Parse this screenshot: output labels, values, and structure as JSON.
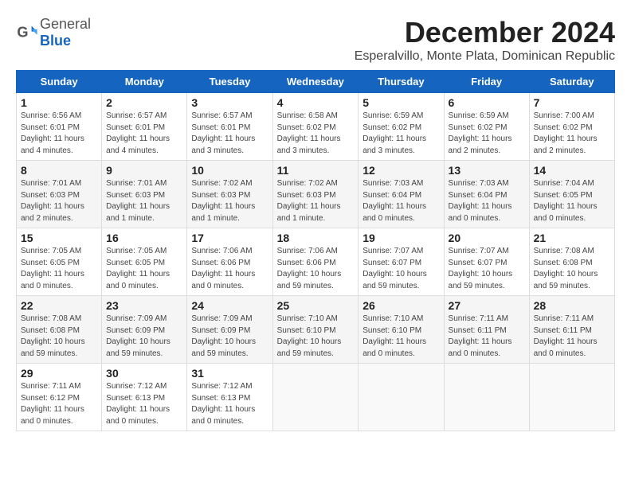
{
  "header": {
    "logo_general": "General",
    "logo_blue": "Blue",
    "month_title": "December 2024",
    "location": "Esperalvillo, Monte Plata, Dominican Republic"
  },
  "weekdays": [
    "Sunday",
    "Monday",
    "Tuesday",
    "Wednesday",
    "Thursday",
    "Friday",
    "Saturday"
  ],
  "weeks": [
    [
      {
        "day": "1",
        "info": "Sunrise: 6:56 AM\nSunset: 6:01 PM\nDaylight: 11 hours and 4 minutes."
      },
      {
        "day": "2",
        "info": "Sunrise: 6:57 AM\nSunset: 6:01 PM\nDaylight: 11 hours and 4 minutes."
      },
      {
        "day": "3",
        "info": "Sunrise: 6:57 AM\nSunset: 6:01 PM\nDaylight: 11 hours and 3 minutes."
      },
      {
        "day": "4",
        "info": "Sunrise: 6:58 AM\nSunset: 6:02 PM\nDaylight: 11 hours and 3 minutes."
      },
      {
        "day": "5",
        "info": "Sunrise: 6:59 AM\nSunset: 6:02 PM\nDaylight: 11 hours and 3 minutes."
      },
      {
        "day": "6",
        "info": "Sunrise: 6:59 AM\nSunset: 6:02 PM\nDaylight: 11 hours and 2 minutes."
      },
      {
        "day": "7",
        "info": "Sunrise: 7:00 AM\nSunset: 6:02 PM\nDaylight: 11 hours and 2 minutes."
      }
    ],
    [
      {
        "day": "8",
        "info": "Sunrise: 7:01 AM\nSunset: 6:03 PM\nDaylight: 11 hours and 2 minutes."
      },
      {
        "day": "9",
        "info": "Sunrise: 7:01 AM\nSunset: 6:03 PM\nDaylight: 11 hours and 1 minute."
      },
      {
        "day": "10",
        "info": "Sunrise: 7:02 AM\nSunset: 6:03 PM\nDaylight: 11 hours and 1 minute."
      },
      {
        "day": "11",
        "info": "Sunrise: 7:02 AM\nSunset: 6:03 PM\nDaylight: 11 hours and 1 minute."
      },
      {
        "day": "12",
        "info": "Sunrise: 7:03 AM\nSunset: 6:04 PM\nDaylight: 11 hours and 0 minutes."
      },
      {
        "day": "13",
        "info": "Sunrise: 7:03 AM\nSunset: 6:04 PM\nDaylight: 11 hours and 0 minutes."
      },
      {
        "day": "14",
        "info": "Sunrise: 7:04 AM\nSunset: 6:05 PM\nDaylight: 11 hours and 0 minutes."
      }
    ],
    [
      {
        "day": "15",
        "info": "Sunrise: 7:05 AM\nSunset: 6:05 PM\nDaylight: 11 hours and 0 minutes."
      },
      {
        "day": "16",
        "info": "Sunrise: 7:05 AM\nSunset: 6:05 PM\nDaylight: 11 hours and 0 minutes."
      },
      {
        "day": "17",
        "info": "Sunrise: 7:06 AM\nSunset: 6:06 PM\nDaylight: 11 hours and 0 minutes."
      },
      {
        "day": "18",
        "info": "Sunrise: 7:06 AM\nSunset: 6:06 PM\nDaylight: 10 hours and 59 minutes."
      },
      {
        "day": "19",
        "info": "Sunrise: 7:07 AM\nSunset: 6:07 PM\nDaylight: 10 hours and 59 minutes."
      },
      {
        "day": "20",
        "info": "Sunrise: 7:07 AM\nSunset: 6:07 PM\nDaylight: 10 hours and 59 minutes."
      },
      {
        "day": "21",
        "info": "Sunrise: 7:08 AM\nSunset: 6:08 PM\nDaylight: 10 hours and 59 minutes."
      }
    ],
    [
      {
        "day": "22",
        "info": "Sunrise: 7:08 AM\nSunset: 6:08 PM\nDaylight: 10 hours and 59 minutes."
      },
      {
        "day": "23",
        "info": "Sunrise: 7:09 AM\nSunset: 6:09 PM\nDaylight: 10 hours and 59 minutes."
      },
      {
        "day": "24",
        "info": "Sunrise: 7:09 AM\nSunset: 6:09 PM\nDaylight: 10 hours and 59 minutes."
      },
      {
        "day": "25",
        "info": "Sunrise: 7:10 AM\nSunset: 6:10 PM\nDaylight: 10 hours and 59 minutes."
      },
      {
        "day": "26",
        "info": "Sunrise: 7:10 AM\nSunset: 6:10 PM\nDaylight: 11 hours and 0 minutes."
      },
      {
        "day": "27",
        "info": "Sunrise: 7:11 AM\nSunset: 6:11 PM\nDaylight: 11 hours and 0 minutes."
      },
      {
        "day": "28",
        "info": "Sunrise: 7:11 AM\nSunset: 6:11 PM\nDaylight: 11 hours and 0 minutes."
      }
    ],
    [
      {
        "day": "29",
        "info": "Sunrise: 7:11 AM\nSunset: 6:12 PM\nDaylight: 11 hours and 0 minutes."
      },
      {
        "day": "30",
        "info": "Sunrise: 7:12 AM\nSunset: 6:13 PM\nDaylight: 11 hours and 0 minutes."
      },
      {
        "day": "31",
        "info": "Sunrise: 7:12 AM\nSunset: 6:13 PM\nDaylight: 11 hours and 0 minutes."
      },
      null,
      null,
      null,
      null
    ]
  ]
}
